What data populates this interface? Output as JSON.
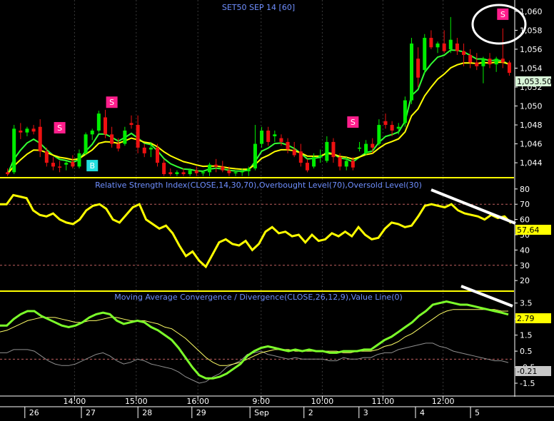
{
  "chart_data": [
    {
      "type": "candlestick",
      "title": "SET50 SEP 14   [60]",
      "ylim": [
        1042.5,
        1061.2
      ],
      "y_ticks": [
        "1,044",
        "1,046",
        "1,048",
        "1,050",
        "1,052",
        "1,054",
        "1,056",
        "1,058",
        "1,060"
      ],
      "last_price_label": "1,053.50",
      "last_price": 1053.5,
      "series": [
        {
          "name": "Fast EMA",
          "color": "#33ff33"
        },
        {
          "name": "Slow EMA",
          "color": "#ffff00"
        }
      ],
      "candles": [
        {
          "o": 1043.0,
          "h": 1043.4,
          "l": 1042.6,
          "c": 1042.8
        },
        {
          "o": 1043.0,
          "h": 1048.0,
          "l": 1042.8,
          "c": 1047.6
        },
        {
          "o": 1047.4,
          "h": 1048.2,
          "l": 1046.5,
          "c": 1047.2
        },
        {
          "o": 1047.2,
          "h": 1047.8,
          "l": 1046.8,
          "c": 1047.6
        },
        {
          "o": 1047.6,
          "h": 1048.0,
          "l": 1047.0,
          "c": 1047.3
        },
        {
          "o": 1047.8,
          "h": 1048.6,
          "l": 1044.6,
          "c": 1045.2
        },
        {
          "o": 1045.2,
          "h": 1045.6,
          "l": 1043.6,
          "c": 1044.0
        },
        {
          "o": 1044.0,
          "h": 1044.6,
          "l": 1043.2,
          "c": 1043.6
        },
        {
          "o": 1043.6,
          "h": 1044.2,
          "l": 1043.0,
          "c": 1043.5
        },
        {
          "o": 1043.8,
          "h": 1044.2,
          "l": 1043.2,
          "c": 1044.0
        },
        {
          "o": 1044.1,
          "h": 1044.8,
          "l": 1043.4,
          "c": 1043.6
        },
        {
          "o": 1043.6,
          "h": 1045.4,
          "l": 1043.4,
          "c": 1045.0
        },
        {
          "o": 1045.0,
          "h": 1047.2,
          "l": 1044.8,
          "c": 1047.0
        },
        {
          "o": 1047.0,
          "h": 1047.6,
          "l": 1046.4,
          "c": 1047.4
        },
        {
          "o": 1047.4,
          "h": 1049.5,
          "l": 1047.2,
          "c": 1049.2
        },
        {
          "o": 1048.8,
          "h": 1049.6,
          "l": 1046.6,
          "c": 1047.0
        },
        {
          "o": 1047.0,
          "h": 1047.8,
          "l": 1045.6,
          "c": 1046.0
        },
        {
          "o": 1046.0,
          "h": 1046.6,
          "l": 1045.2,
          "c": 1045.5
        },
        {
          "o": 1046.0,
          "h": 1047.8,
          "l": 1045.8,
          "c": 1047.4
        },
        {
          "o": 1048.2,
          "h": 1049.0,
          "l": 1047.6,
          "c": 1048.0
        },
        {
          "o": 1048.0,
          "h": 1049.0,
          "l": 1045.0,
          "c": 1045.6
        },
        {
          "o": 1045.6,
          "h": 1046.0,
          "l": 1044.6,
          "c": 1045.0
        },
        {
          "o": 1045.4,
          "h": 1046.2,
          "l": 1044.6,
          "c": 1045.6
        },
        {
          "o": 1045.6,
          "h": 1046.0,
          "l": 1043.6,
          "c": 1044.0
        },
        {
          "o": 1044.0,
          "h": 1044.4,
          "l": 1042.6,
          "c": 1042.8
        },
        {
          "o": 1043.0,
          "h": 1043.4,
          "l": 1042.6,
          "c": 1042.8
        },
        {
          "o": 1042.8,
          "h": 1043.2,
          "l": 1042.6,
          "c": 1043.0
        },
        {
          "o": 1043.0,
          "h": 1043.4,
          "l": 1042.6,
          "c": 1042.8
        },
        {
          "o": 1042.8,
          "h": 1043.4,
          "l": 1042.6,
          "c": 1043.2
        },
        {
          "o": 1043.2,
          "h": 1043.6,
          "l": 1042.6,
          "c": 1042.9
        },
        {
          "o": 1042.9,
          "h": 1043.2,
          "l": 1042.6,
          "c": 1043.0
        },
        {
          "o": 1043.0,
          "h": 1044.0,
          "l": 1042.6,
          "c": 1043.8
        },
        {
          "o": 1043.8,
          "h": 1044.4,
          "l": 1043.0,
          "c": 1043.6
        },
        {
          "o": 1043.6,
          "h": 1044.2,
          "l": 1043.0,
          "c": 1043.2
        },
        {
          "o": 1043.2,
          "h": 1043.6,
          "l": 1042.6,
          "c": 1042.9
        },
        {
          "o": 1042.9,
          "h": 1043.2,
          "l": 1042.6,
          "c": 1043.0
        },
        {
          "o": 1043.0,
          "h": 1043.4,
          "l": 1042.6,
          "c": 1043.1
        },
        {
          "o": 1043.1,
          "h": 1043.6,
          "l": 1042.6,
          "c": 1043.4
        },
        {
          "o": 1043.4,
          "h": 1048.0,
          "l": 1043.2,
          "c": 1046.0
        },
        {
          "o": 1046.0,
          "h": 1047.8,
          "l": 1045.6,
          "c": 1047.4
        },
        {
          "o": 1047.4,
          "h": 1047.8,
          "l": 1045.8,
          "c": 1046.2
        },
        {
          "o": 1046.8,
          "h": 1047.4,
          "l": 1046.2,
          "c": 1047.0
        },
        {
          "o": 1046.6,
          "h": 1047.0,
          "l": 1045.8,
          "c": 1046.2
        },
        {
          "o": 1046.2,
          "h": 1046.6,
          "l": 1045.0,
          "c": 1045.4
        },
        {
          "o": 1045.4,
          "h": 1046.2,
          "l": 1044.6,
          "c": 1044.8
        },
        {
          "o": 1045.2,
          "h": 1046.0,
          "l": 1043.6,
          "c": 1044.0
        },
        {
          "o": 1044.0,
          "h": 1044.4,
          "l": 1043.0,
          "c": 1043.2
        },
        {
          "o": 1043.6,
          "h": 1045.0,
          "l": 1043.4,
          "c": 1044.6
        },
        {
          "o": 1044.6,
          "h": 1045.4,
          "l": 1044.0,
          "c": 1044.8
        },
        {
          "o": 1044.2,
          "h": 1046.8,
          "l": 1044.0,
          "c": 1046.2
        },
        {
          "o": 1046.2,
          "h": 1046.6,
          "l": 1044.0,
          "c": 1044.6
        },
        {
          "o": 1044.6,
          "h": 1045.0,
          "l": 1043.2,
          "c": 1043.6
        },
        {
          "o": 1043.6,
          "h": 1044.6,
          "l": 1043.2,
          "c": 1044.2
        },
        {
          "o": 1044.2,
          "h": 1044.6,
          "l": 1043.2,
          "c": 1043.5
        },
        {
          "o": 1045.6,
          "h": 1046.2,
          "l": 1045.2,
          "c": 1045.6
        },
        {
          "o": 1045.0,
          "h": 1046.4,
          "l": 1044.8,
          "c": 1046.0
        },
        {
          "o": 1046.0,
          "h": 1046.6,
          "l": 1045.0,
          "c": 1045.6
        },
        {
          "o": 1046.0,
          "h": 1048.6,
          "l": 1045.8,
          "c": 1048.0
        },
        {
          "o": 1048.4,
          "h": 1049.2,
          "l": 1047.6,
          "c": 1048.0
        },
        {
          "o": 1048.0,
          "h": 1048.4,
          "l": 1046.8,
          "c": 1047.4
        },
        {
          "o": 1047.6,
          "h": 1048.2,
          "l": 1047.0,
          "c": 1047.8
        },
        {
          "o": 1048.2,
          "h": 1051.0,
          "l": 1047.8,
          "c": 1050.6
        },
        {
          "o": 1050.6,
          "h": 1057.2,
          "l": 1050.2,
          "c": 1056.6
        },
        {
          "o": 1055.0,
          "h": 1056.2,
          "l": 1052.0,
          "c": 1053.0
        },
        {
          "o": 1053.8,
          "h": 1057.6,
          "l": 1053.4,
          "c": 1057.2
        },
        {
          "o": 1057.2,
          "h": 1058.0,
          "l": 1056.0,
          "c": 1056.2
        },
        {
          "o": 1056.2,
          "h": 1056.8,
          "l": 1055.6,
          "c": 1056.6
        },
        {
          "o": 1056.6,
          "h": 1058.0,
          "l": 1055.6,
          "c": 1055.8
        },
        {
          "o": 1056.0,
          "h": 1059.4,
          "l": 1055.6,
          "c": 1057.0
        },
        {
          "o": 1056.6,
          "h": 1057.2,
          "l": 1055.4,
          "c": 1055.8
        },
        {
          "o": 1055.8,
          "h": 1056.6,
          "l": 1054.2,
          "c": 1055.4
        },
        {
          "o": 1055.4,
          "h": 1056.0,
          "l": 1054.0,
          "c": 1054.6
        },
        {
          "o": 1054.6,
          "h": 1055.6,
          "l": 1053.8,
          "c": 1054.2
        },
        {
          "o": 1054.2,
          "h": 1055.2,
          "l": 1052.4,
          "c": 1055.0
        },
        {
          "o": 1055.0,
          "h": 1055.6,
          "l": 1054.0,
          "c": 1054.4
        },
        {
          "o": 1054.4,
          "h": 1055.2,
          "l": 1053.6,
          "c": 1055.0
        },
        {
          "o": 1055.0,
          "h": 1058.2,
          "l": 1054.0,
          "c": 1054.6
        },
        {
          "o": 1054.6,
          "h": 1054.8,
          "l": 1053.2,
          "c": 1053.5
        }
      ],
      "signals": [
        {
          "label": "S",
          "index": 8,
          "value": 1047.7,
          "color": "#ff1e8c"
        },
        {
          "label": "S",
          "index": 16,
          "value": 1050.4,
          "color": "#ff1e8c"
        },
        {
          "label": "B",
          "index": 13,
          "value": 1043.7,
          "color": "#22dddd"
        },
        {
          "label": "S",
          "index": 53,
          "value": 1048.3,
          "color": "#ff1e8c"
        },
        {
          "label": "S",
          "index": 76,
          "value": 1059.7,
          "color": "#ff1e8c"
        }
      ]
    },
    {
      "type": "line",
      "title": "Relative Strength Index(CLOSE,14,30,70),Overbought Level(70),Oversold Level(30)",
      "ylim": [
        14,
        86
      ],
      "y_ticks": [
        "20",
        "30",
        "40",
        "50",
        "60",
        "70",
        "80"
      ],
      "levels": [
        70,
        30
      ],
      "last_value_label": "57.64",
      "series": [
        {
          "name": "RSI",
          "color": "#ffff00",
          "values": [
            70,
            70,
            76,
            75,
            74,
            66,
            63,
            62,
            64,
            60,
            58,
            57,
            60,
            66,
            69,
            70,
            67,
            60,
            58,
            63,
            68,
            70,
            60,
            57,
            54,
            56,
            51,
            43,
            36,
            39,
            33,
            29,
            37,
            45,
            47,
            44,
            43,
            46,
            40,
            44,
            52,
            55,
            51,
            52,
            49,
            50,
            45,
            50,
            46,
            47,
            51,
            49,
            52,
            49,
            55,
            50,
            47,
            48,
            54,
            58,
            57,
            55,
            56,
            62,
            69,
            70,
            69,
            68,
            70,
            66,
            64,
            63,
            62,
            60,
            63,
            61,
            62,
            57.64
          ]
        }
      ]
    },
    {
      "type": "line",
      "title": "Moving Average Convergence / Divergence(CLOSE,26,12,9),Value Line(0)",
      "ylim": [
        -2.3,
        4.2
      ],
      "y_ticks": [
        "-1.5",
        "-0.5",
        "0.5",
        "1.5",
        "2.5",
        "3.5"
      ],
      "levels": [
        0
      ],
      "last_value_labels": [
        "2.79",
        "-0.21"
      ],
      "series": [
        {
          "name": "MACD",
          "color": "#7cff2a",
          "values": [
            2.1,
            2.1,
            2.5,
            2.8,
            3.0,
            3.0,
            2.7,
            2.5,
            2.3,
            2.1,
            2.0,
            2.1,
            2.3,
            2.6,
            2.8,
            2.9,
            2.8,
            2.4,
            2.2,
            2.3,
            2.4,
            2.3,
            2.0,
            1.8,
            1.5,
            1.2,
            0.7,
            0.1,
            -0.5,
            -1.0,
            -1.2,
            -1.2,
            -1.1,
            -0.9,
            -0.6,
            -0.3,
            0.2,
            0.5,
            0.7,
            0.8,
            0.7,
            0.6,
            0.5,
            0.6,
            0.5,
            0.6,
            0.5,
            0.5,
            0.4,
            0.4,
            0.5,
            0.5,
            0.5,
            0.6,
            0.6,
            0.9,
            1.2,
            1.4,
            1.7,
            2.0,
            2.3,
            2.7,
            3.0,
            3.4,
            3.5,
            3.6,
            3.5,
            3.4,
            3.4,
            3.3,
            3.2,
            3.1,
            3.0,
            2.9,
            2.79
          ]
        },
        {
          "name": "Signal",
          "color": "#ffff66",
          "values": [
            1.7,
            1.8,
            2.0,
            2.2,
            2.4,
            2.5,
            2.6,
            2.6,
            2.6,
            2.5,
            2.4,
            2.3,
            2.3,
            2.4,
            2.4,
            2.5,
            2.6,
            2.6,
            2.5,
            2.4,
            2.4,
            2.4,
            2.3,
            2.2,
            2.0,
            1.9,
            1.6,
            1.3,
            0.9,
            0.5,
            0.1,
            -0.2,
            -0.4,
            -0.4,
            -0.3,
            -0.2,
            0.0,
            0.2,
            0.4,
            0.5,
            0.6,
            0.6,
            0.6,
            0.5,
            0.5,
            0.5,
            0.5,
            0.5,
            0.5,
            0.5,
            0.4,
            0.4,
            0.5,
            0.5,
            0.5,
            0.6,
            0.8,
            0.9,
            1.1,
            1.4,
            1.6,
            1.9,
            2.2,
            2.5,
            2.8,
            3.0,
            3.1,
            3.1,
            3.1,
            3.1,
            3.1,
            3.1,
            3.1,
            3.0,
            3.0
          ]
        },
        {
          "name": "Histogram",
          "color": "#909090",
          "values": [
            0.4,
            0.4,
            0.6,
            0.6,
            0.6,
            0.5,
            0.2,
            -0.1,
            -0.3,
            -0.4,
            -0.4,
            -0.3,
            -0.1,
            0.1,
            0.3,
            0.4,
            0.2,
            -0.1,
            -0.3,
            -0.2,
            0.0,
            -0.1,
            -0.3,
            -0.4,
            -0.5,
            -0.6,
            -0.8,
            -1.1,
            -1.3,
            -1.5,
            -1.4,
            -1.1,
            -0.9,
            -0.5,
            -0.3,
            -0.1,
            0.3,
            0.4,
            0.5,
            0.3,
            0.2,
            0.1,
            0.0,
            0.1,
            0.0,
            0.0,
            0.0,
            0.0,
            -0.1,
            -0.1,
            0.1,
            0.0,
            0.0,
            0.1,
            0.1,
            0.3,
            0.4,
            0.4,
            0.6,
            0.7,
            0.8,
            0.9,
            1.0,
            1.0,
            0.8,
            0.7,
            0.5,
            0.4,
            0.3,
            0.2,
            0.1,
            0.0,
            -0.1,
            -0.1,
            -0.21
          ]
        }
      ]
    }
  ],
  "x_axis": {
    "time_labels": [
      {
        "text": "14:00",
        "frac": 0.145
      },
      {
        "text": "15:00",
        "frac": 0.265
      },
      {
        "text": "16:00",
        "frac": 0.385
      },
      {
        "text": "9:00",
        "frac": 0.508
      },
      {
        "text": "10:00",
        "frac": 0.627
      },
      {
        "text": "11:00",
        "frac": 0.745
      },
      {
        "text": "12:00",
        "frac": 0.862
      }
    ],
    "day_labels": [
      {
        "text": "26",
        "frac": 0.09
      },
      {
        "text": "27",
        "frac": 0.2
      },
      {
        "text": "28",
        "frac": 0.31
      },
      {
        "text": "29",
        "frac": 0.415
      },
      {
        "text": "Sep",
        "frac": 0.528
      },
      {
        "text": "2",
        "frac": 0.633
      },
      {
        "text": "3",
        "frac": 0.74
      },
      {
        "text": "4",
        "frac": 0.85
      },
      {
        "text": "5",
        "frac": 0.957
      }
    ],
    "grid_fracs": [
      0.145,
      0.265,
      0.385,
      0.508,
      0.627,
      0.745,
      0.862
    ]
  },
  "annotations": {
    "circle_color": "#ffffff",
    "trend_line_color": "#ffffff"
  }
}
